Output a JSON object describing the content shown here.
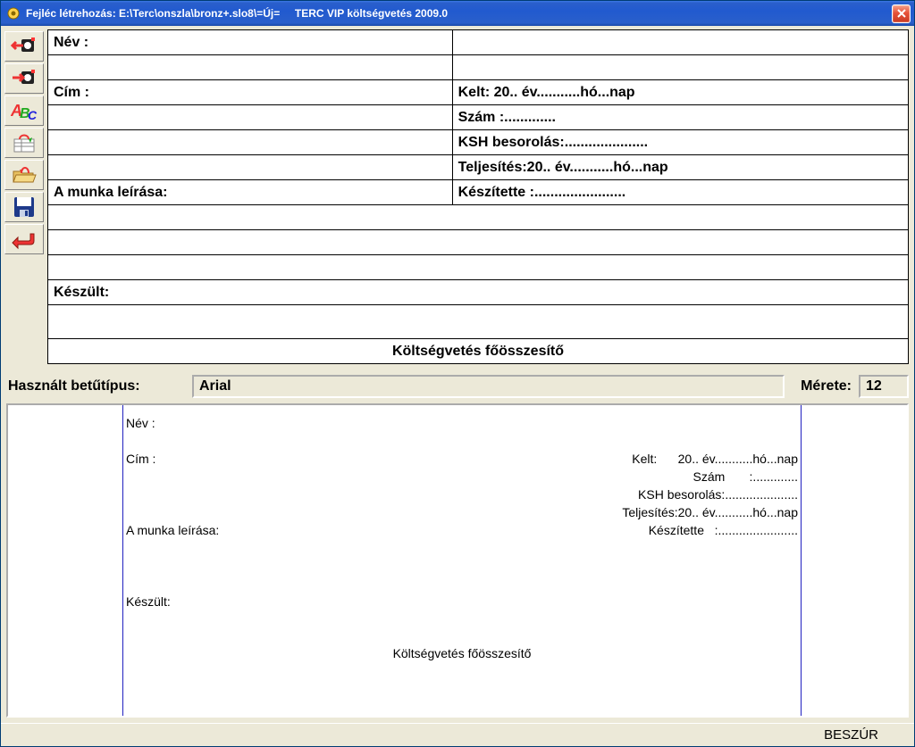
{
  "window": {
    "title": "Fejléc létrehozás: E:\\Terc\\onszla\\bronz+.slo8\\=Új=     TERC VIP költségvetés 2009.0"
  },
  "toolbar_icons": {
    "import_left": "import-left-icon",
    "import_right": "import-right-icon",
    "spellcheck": "spellcheck-icon",
    "template_up": "template-up-icon",
    "template_down": "template-down-icon",
    "save": "save-icon",
    "back": "back-icon"
  },
  "form": {
    "nev_label": "Név :",
    "nev_value": "",
    "cim_label": "Cím :",
    "kelt_label": "Kelt:      20.. év...........hó...nap",
    "szam_label": "Szám       :.............",
    "ksh_label": "KSH besorolás:.....................",
    "teljesites_label": "Teljesítés:20.. év...........hó...nap",
    "munka_label": "A munka leírása:",
    "keszitette_label": "Készítette   :.......................",
    "keszult_label": "Készült:",
    "summary_title": "Költségvetés főösszesítő"
  },
  "font": {
    "label": "Használt betűtípus:",
    "name": "Arial",
    "size_label": "Mérete:",
    "size": "12"
  },
  "preview": {
    "nev": "Név :",
    "cim": "Cím :",
    "munka": "A munka leírása:",
    "keszult": "Készült:",
    "kelt": "Kelt:      20.. év...........hó...nap",
    "szam": "Szám       :.............",
    "ksh": "KSH besorolás:.....................",
    "teljesites": "Teljesítés:20.. év...........hó...nap",
    "keszitette": "Készítette   :.......................",
    "summary": "Költségvetés főösszesítő"
  },
  "status": {
    "insert": "BESZÚR"
  }
}
